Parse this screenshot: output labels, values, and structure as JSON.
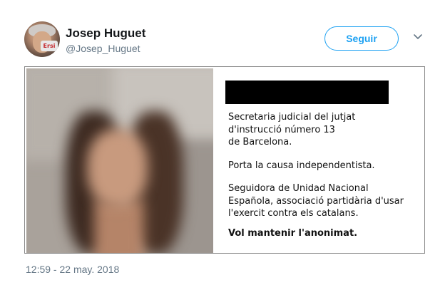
{
  "author": {
    "name": "Josep Huguet",
    "handle": "@Josep_Huguet",
    "avatar_badge": "Ersi"
  },
  "actions": {
    "follow_label": "Seguir",
    "more_icon": "chevron-down-icon"
  },
  "card": {
    "photo": "blurred-portrait",
    "redaction": "black-box",
    "lines_1": [
      "Secretaria judicial del jutjat",
      "d'instrucció número 13",
      "de Barcelona."
    ],
    "line_2": "Porta la causa independentista.",
    "lines_3": [
      "Seguidora de Unidad Nacional",
      "Española, associació partidària d'usar",
      "l'exercit contra els catalans."
    ],
    "line_4": "Vol mantenir l'anonimat."
  },
  "timestamp": "12:59 - 22 may. 2018",
  "colors": {
    "accent": "#1da1f2",
    "secondary_text": "#657786"
  }
}
